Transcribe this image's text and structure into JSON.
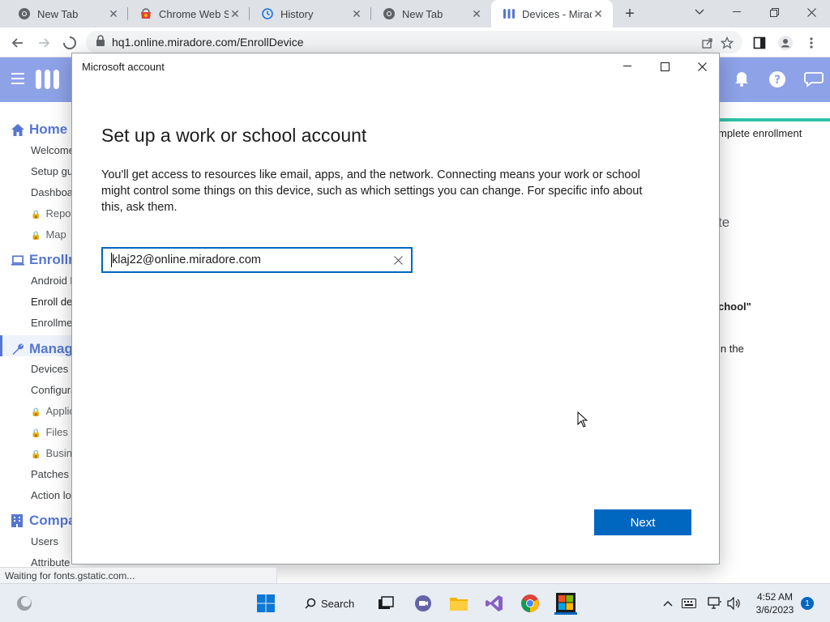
{
  "browser": {
    "tabs": [
      {
        "title": "New Tab",
        "icon": "chrome-icon"
      },
      {
        "title": "Chrome Web St",
        "icon": "chrome-web-store-icon"
      },
      {
        "title": "History",
        "icon": "history-icon"
      },
      {
        "title": "New Tab",
        "icon": "chrome-icon"
      },
      {
        "title": "Devices - Mirad",
        "icon": "miradore-icon",
        "active": true
      }
    ],
    "url": "hq1.online.miradore.com/EnrollDevice",
    "status_text": "Waiting for fonts.gstatic.com..."
  },
  "app": {
    "brand_color": "#8ea2e8",
    "sidebar": {
      "sections": [
        {
          "label": "Home",
          "icon": "home-icon"
        },
        {
          "label": "Enrollm",
          "icon": "laptop-icon"
        },
        {
          "label": "Manag",
          "icon": "wrench-icon"
        },
        {
          "label": "Compa",
          "icon": "building-icon"
        }
      ],
      "items": [
        {
          "label": "Welcome"
        },
        {
          "label": "Setup gu"
        },
        {
          "label": "Dashboa"
        },
        {
          "label": "Repor",
          "locked": true
        },
        {
          "label": "Map",
          "locked": true
        },
        {
          "label": "Android E"
        },
        {
          "label": "Enroll de",
          "active": true
        },
        {
          "label": "Enrollme"
        },
        {
          "label": "Devices"
        },
        {
          "label": "Configura"
        },
        {
          "label": "Applic",
          "locked": true
        },
        {
          "label": "Files a",
          "locked": true
        },
        {
          "label": "Busin",
          "locked": true
        },
        {
          "label": "Patches"
        },
        {
          "label": "Action lo"
        },
        {
          "label": "Users"
        },
        {
          "label": "Attribute"
        }
      ]
    },
    "right_fragments": [
      "mplete enrollment",
      "te",
      "chool\"",
      "in the"
    ]
  },
  "dialog": {
    "title": "Microsoft account",
    "heading": "Set up a work or school account",
    "description": "You'll get access to resources like email, apps, and the network. Connecting means your work or school might control some things on this device, such as which settings you can change. For specific info about this, ask them.",
    "email_value": "klaj22@online.miradore.com",
    "next_label": "Next",
    "accent": "#0067c0"
  },
  "taskbar": {
    "search_label": "Search",
    "time": "4:52 AM",
    "date": "3/6/2023",
    "notification_count": "1"
  }
}
